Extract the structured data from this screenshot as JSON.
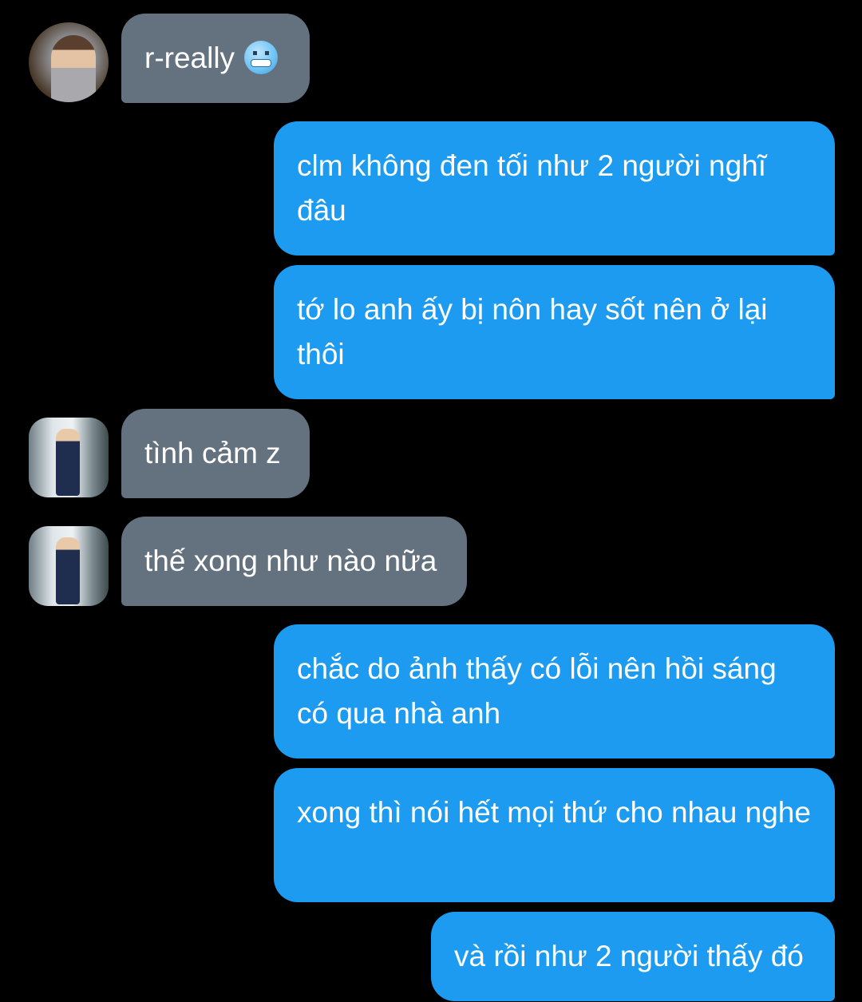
{
  "messages": [
    {
      "direction": "incoming",
      "avatar": "avatar-headphones",
      "text": "r-really",
      "emoji": "cold-face-emoji"
    },
    {
      "direction": "outgoing",
      "text": "clm không đen tối như 2 người nghĩ đâu"
    },
    {
      "direction": "outgoing",
      "text": "tớ lo anh ấy bị nôn hay sốt nên ở lại thôi"
    },
    {
      "direction": "incoming",
      "avatar": "avatar-jersey-12",
      "text": "tình cảm z"
    },
    {
      "direction": "incoming",
      "avatar": "avatar-jersey-12",
      "text": "thế xong như nào nữa"
    },
    {
      "direction": "outgoing",
      "text": "chắc do ảnh thấy có lỗi nên hồi sáng có qua nhà anh"
    },
    {
      "direction": "outgoing",
      "text": "xong thì nói hết mọi thứ cho nhau nghe"
    },
    {
      "direction": "outgoing",
      "text": "và rồi như 2 người thấy đó"
    }
  ],
  "colors": {
    "background": "#000000",
    "incoming_bubble": "#64717e",
    "outgoing_bubble": "#1d9bf0",
    "text": "#ffffff"
  }
}
